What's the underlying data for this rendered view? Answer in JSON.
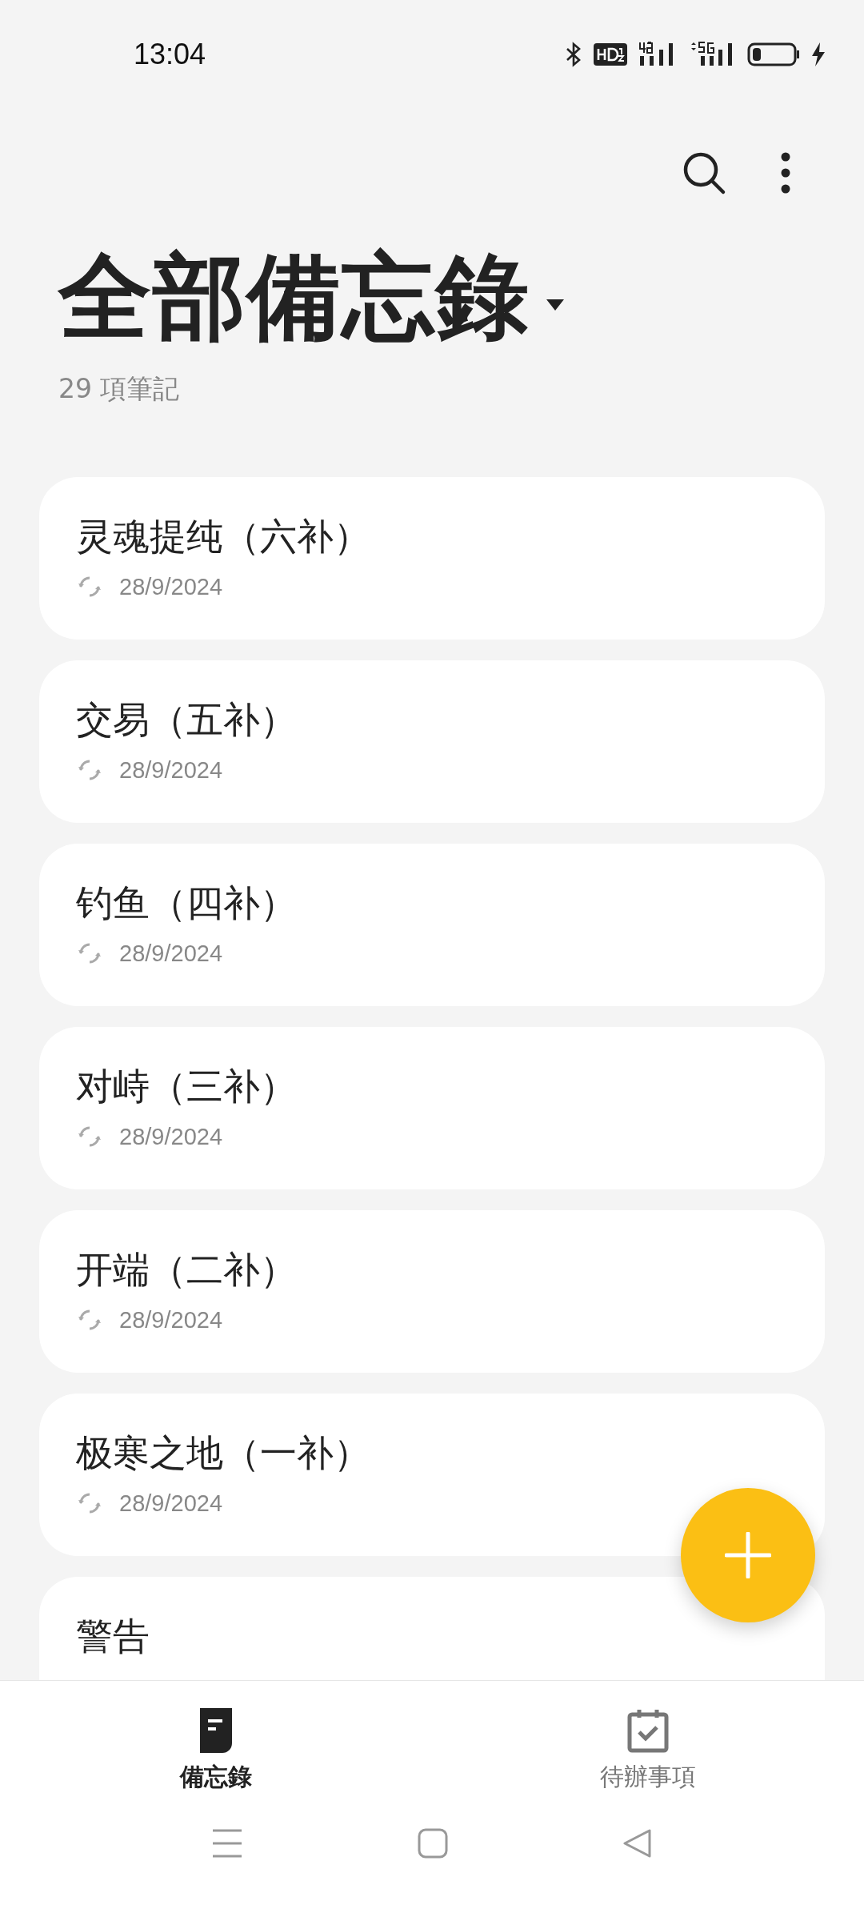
{
  "status_bar": {
    "time": "13:04"
  },
  "header": {
    "title": "全部備忘錄",
    "subtitle": "29 項筆記"
  },
  "notes": [
    {
      "title": "灵魂提纯（六补）",
      "date": "28/9/2024",
      "synced": true
    },
    {
      "title": "交易（五补）",
      "date": "28/9/2024",
      "synced": true
    },
    {
      "title": "钓鱼（四补）",
      "date": "28/9/2024",
      "synced": true
    },
    {
      "title": "对峙（三补）",
      "date": "28/9/2024",
      "synced": true
    },
    {
      "title": "开端（二补）",
      "date": "28/9/2024",
      "synced": true
    },
    {
      "title": "极寒之地（一补）",
      "date": "28/9/2024",
      "synced": true
    },
    {
      "title": "警告"
    }
  ],
  "tabs": [
    {
      "label": "備忘錄",
      "kind": "notes",
      "selected": true
    },
    {
      "label": "待辦事項",
      "kind": "todo",
      "selected": false
    }
  ]
}
